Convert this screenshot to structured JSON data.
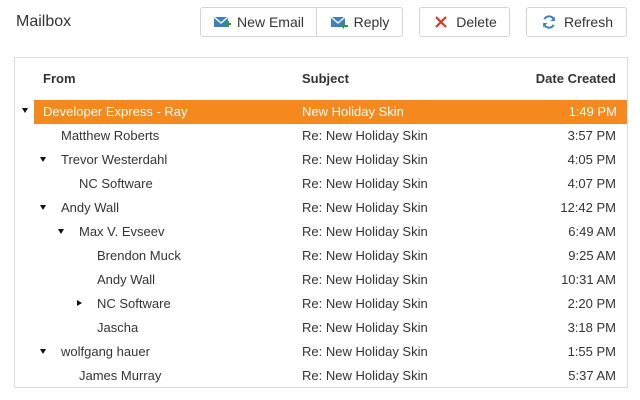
{
  "header": {
    "title": "Mailbox"
  },
  "toolbar": {
    "new_email": "New Email",
    "reply": "Reply",
    "delete": "Delete",
    "refresh": "Refresh"
  },
  "grid": {
    "columns": {
      "from": "From",
      "subject": "Subject",
      "date": "Date Created"
    },
    "rows": [
      {
        "from": "Developer Express - Ray",
        "subject": "New Holiday Skin",
        "date": "1:49 PM"
      },
      {
        "from": "Matthew Roberts",
        "subject": "Re: New Holiday Skin",
        "date": "3:57 PM"
      },
      {
        "from": "Trevor Westerdahl",
        "subject": "Re: New Holiday Skin",
        "date": "4:05 PM"
      },
      {
        "from": "NC Software",
        "subject": "Re: New Holiday Skin",
        "date": "4:07 PM"
      },
      {
        "from": "Andy Wall",
        "subject": "Re: New Holiday Skin",
        "date": "12:42 PM"
      },
      {
        "from": "Max V. Evseev",
        "subject": "Re: New Holiday Skin",
        "date": "6:49 AM"
      },
      {
        "from": "Brendon Muck",
        "subject": "Re: New Holiday Skin",
        "date": "9:25 AM"
      },
      {
        "from": "Andy Wall",
        "subject": "Re: New Holiday Skin",
        "date": "10:31 AM"
      },
      {
        "from": "NC Software",
        "subject": "Re: New Holiday Skin",
        "date": "2:20 PM"
      },
      {
        "from": "Jascha",
        "subject": "Re: New Holiday Skin",
        "date": "3:18 PM"
      },
      {
        "from": "wolfgang hauer",
        "subject": "Re: New Holiday Skin",
        "date": "1:55 PM"
      },
      {
        "from": "James Murray",
        "subject": "Re: New Holiday Skin",
        "date": "5:37 AM"
      }
    ]
  },
  "colors": {
    "accent": "#f5891e",
    "icon_blue": "#3d7fc1",
    "delete_red": "#d9372b"
  }
}
